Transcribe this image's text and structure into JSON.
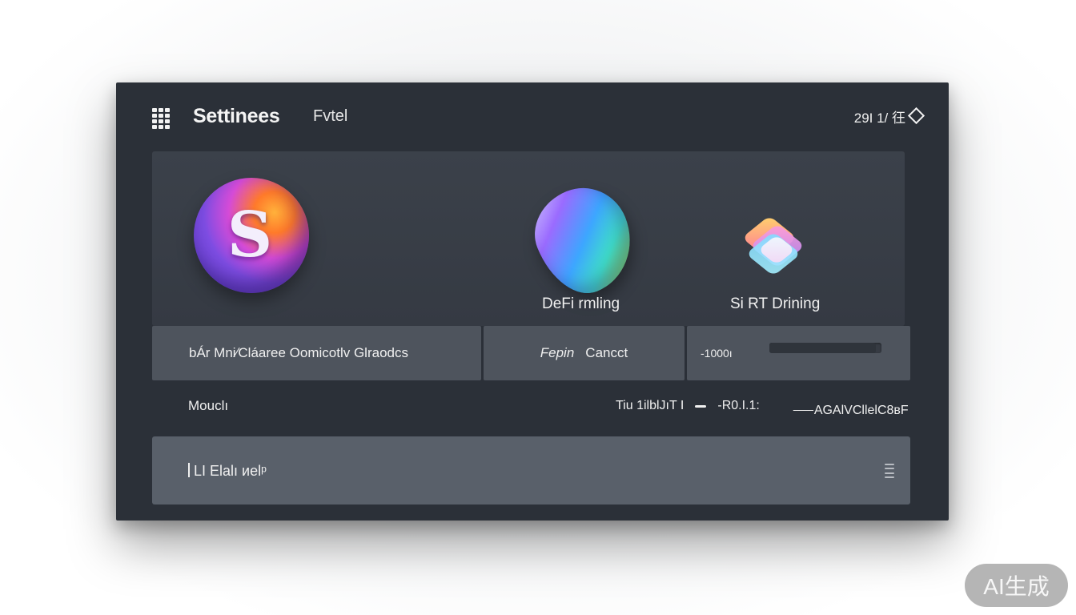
{
  "window": {
    "title": "Settinees",
    "subtitle": "Fvtel",
    "status_text": "29I 1/ 彺",
    "status_icon": "diamond-icon",
    "menu_icon": "grid-icon"
  },
  "hero": {
    "avatar_glyph": "S",
    "apps": [
      {
        "label": "DeFi rmling",
        "icon": "gradient-blob-icon"
      },
      {
        "label": "Si RT Drining",
        "icon": "gradient-cube-icon"
      }
    ]
  },
  "options_row": {
    "left": "bÁr Mni∕Cláaree Oomicotlv Glraodcs",
    "middle_a": "Fepin",
    "middle_b": "Cancct",
    "range_value": "-1000ı",
    "range_fraction": 0.95
  },
  "info_row": {
    "label": "Mouclı",
    "meta_a": "Tiu 1ilblJıT I",
    "meta_b": "-R0.I.1:",
    "right": "⸺AGAlVCllelC8вF"
  },
  "input": {
    "value": "LI Еlalı иelᵖ"
  },
  "badge": {
    "text": "AI生成"
  },
  "colors": {
    "window_bg": "#2b3038",
    "panel_bg": "#4e545d",
    "input_bg": "#59606a",
    "text": "#f0f0f0"
  }
}
